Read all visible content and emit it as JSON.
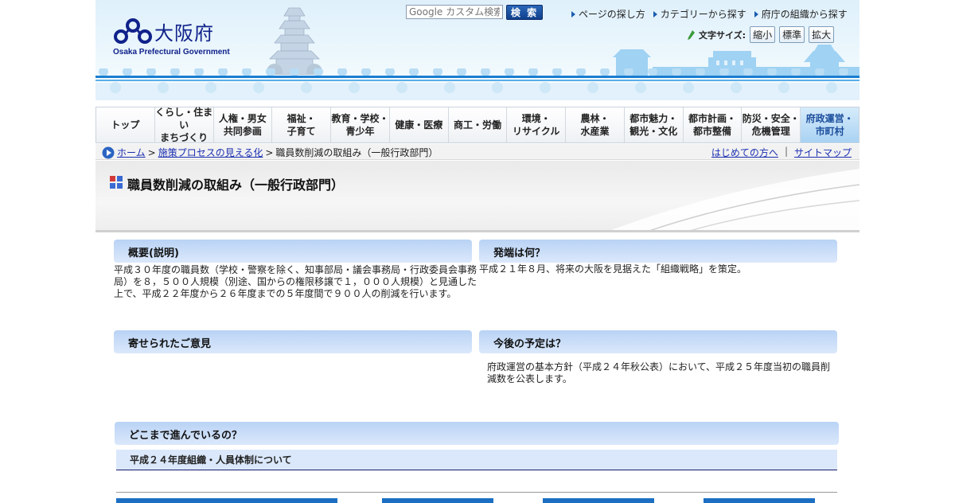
{
  "header": {
    "logo_jp": "大阪府",
    "logo_en": "Osaka Prefectural Government",
    "search_placeholder": "Google カスタム検索",
    "search_button": "検 索",
    "top_links": [
      "ページの探し方",
      "カテゴリーから探す",
      "府庁の組織から探す"
    ],
    "font_size_label": "文字サイズ:",
    "font_size_buttons": [
      "縮小",
      "標準",
      "拡大"
    ]
  },
  "nav": {
    "items": [
      "トップ",
      "くらし・住まい\nまちづくり",
      "人権・男女\n共同参画",
      "福祉・\n子育て",
      "教育・学校・\n青少年",
      "健康・医療",
      "商工・労働",
      "環境・\nリサイクル",
      "農林・\n水産業",
      "都市魅力・\n観光・文化",
      "都市計画・\n都市整備",
      "防災・安全・\n危機管理",
      "府政運営・\n市町村"
    ]
  },
  "breadcrumb": {
    "home": "ホーム",
    "sep1": ">",
    "section": "施策プロセスの見える化",
    "sep2": ">",
    "current": "職員数削減の取組み（一般行政部門）",
    "right_links": [
      "はじめての方へ",
      "サイトマップ"
    ],
    "right_sep": "|"
  },
  "page_title": "職員数削減の取組み（一般行政部門）",
  "panels": {
    "overview": {
      "heading": "概要(説明)",
      "body": "平成３０年度の職員数（学校・警察を除く、知事部局・議会事務局・行政委員会事務局）を８，５００人規模（別途、国からの権限移譲で１，０００人規模）と見通した上で、平成２２年度から２６年度までの５年度間で９００人の削減を行います。"
    },
    "origin": {
      "heading": "発端は何？",
      "body": "平成２１年８月、将来の大阪を見据えた「組織戦略」を策定。"
    },
    "opinions": {
      "heading": "寄せられたご意見",
      "body": ""
    },
    "plan": {
      "heading": "今後の予定は？",
      "body": "府政運営の基本方針（平成２４年秋公表）において、平成２５年度当初の職員削減数を公表します。"
    },
    "progress": {
      "heading": "どこまで進んでいるの？",
      "sub": "平成２４年度組織・人員体制について"
    }
  },
  "colors": {
    "accent": "#1b7ed1",
    "link": "#1b2fb0",
    "panel_header": "#c8dcf7",
    "logo": "#10228a"
  }
}
